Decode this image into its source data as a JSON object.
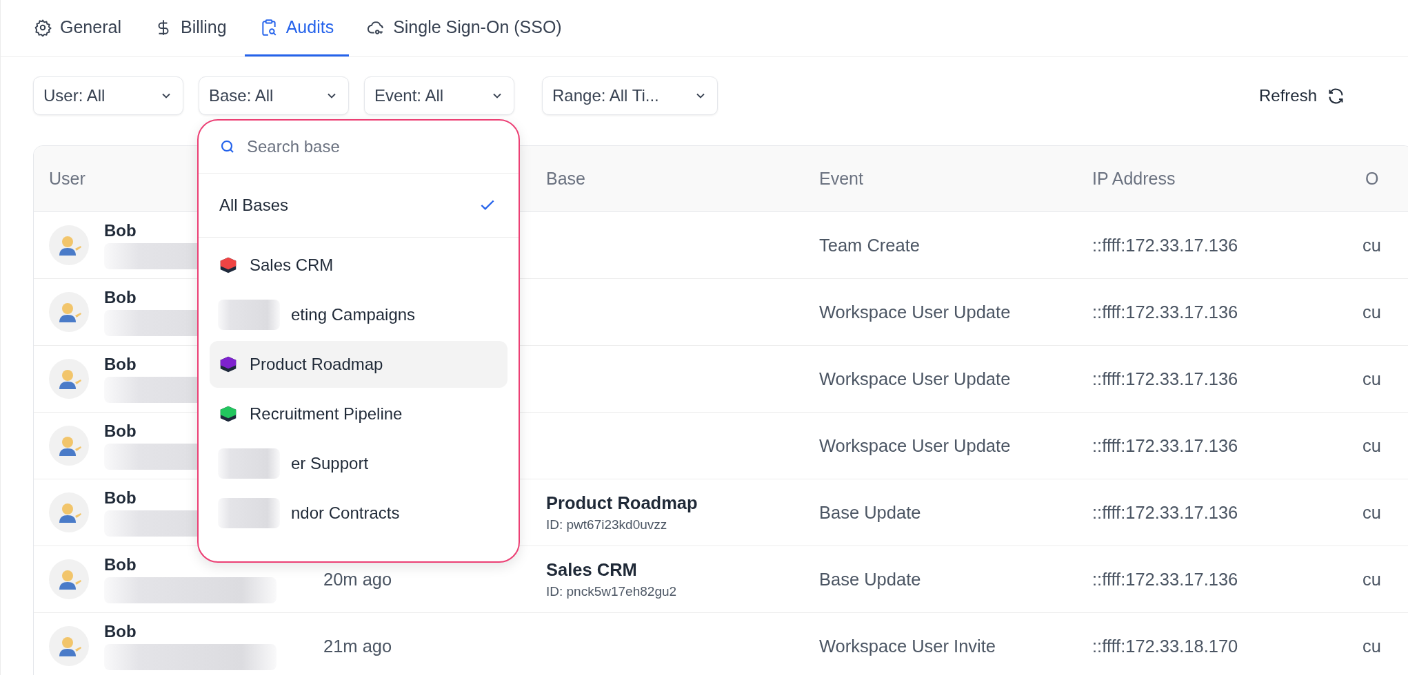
{
  "tabs": [
    {
      "label": "General",
      "selected": false
    },
    {
      "label": "Billing",
      "selected": false
    },
    {
      "label": "Audits",
      "selected": true
    },
    {
      "label": "Single Sign-On (SSO)",
      "selected": false
    }
  ],
  "filters": [
    {
      "label": "User: All"
    },
    {
      "label": "Base: All",
      "dropdown": {
        "search": {
          "placeholder": "Search base"
        },
        "all_option": {
          "label": "All Bases",
          "checked": true
        },
        "items": [
          {
            "label": "Sales CRM",
            "color": "#ef4444",
            "redacted": false,
            "selected": false
          },
          {
            "label": "eting Campaigns",
            "redacted": true,
            "selected": false
          },
          {
            "label": "Product Roadmap",
            "color": "#7e22ce",
            "redacted": false,
            "selected": true
          },
          {
            "label": "Recruitment Pipeline",
            "color": "#22c55e",
            "redacted": false,
            "selected": false
          },
          {
            "label": "er Support",
            "redacted": true,
            "selected": false
          },
          {
            "label": "ndor Contracts",
            "redacted": true,
            "selected": false
          }
        ]
      }
    },
    {
      "label": "Event: All"
    },
    {
      "label": "Range: All Ti..."
    }
  ],
  "refresh": {
    "label": "Refresh"
  },
  "table": {
    "columns": [
      "User",
      "",
      "Base",
      "Event",
      "IP Address",
      "O"
    ],
    "rows": [
      {
        "user": "Bob",
        "event": "Team Create",
        "ip": "::ffff:172.33.17.136",
        "os": "cu"
      },
      {
        "user": "Bob",
        "event": "Workspace User Update",
        "ip": "::ffff:172.33.17.136",
        "os": "cu"
      },
      {
        "user": "Bob",
        "event": "Workspace User Update",
        "ip": "::ffff:172.33.17.136",
        "os": "cu"
      },
      {
        "user": "Bob",
        "event": "Workspace User Update",
        "ip": "::ffff:172.33.17.136",
        "os": "cu"
      },
      {
        "user": "Bob",
        "base": {
          "name": "Product Roadmap",
          "id": "ID: pwt67i23kd0uvzz"
        },
        "event": "Base Update",
        "ip": "::ffff:172.33.17.136",
        "os": "cu"
      },
      {
        "user": "Bob",
        "time": "20m ago",
        "base": {
          "name": "Sales CRM",
          "id": "ID: pnck5w17eh82gu2"
        },
        "event": "Base Update",
        "ip": "::ffff:172.33.17.136",
        "os": "cu"
      },
      {
        "user": "Bob",
        "time": "21m ago",
        "event": "Workspace User Invite",
        "ip": "::ffff:172.33.18.170",
        "os": "cu"
      }
    ]
  }
}
